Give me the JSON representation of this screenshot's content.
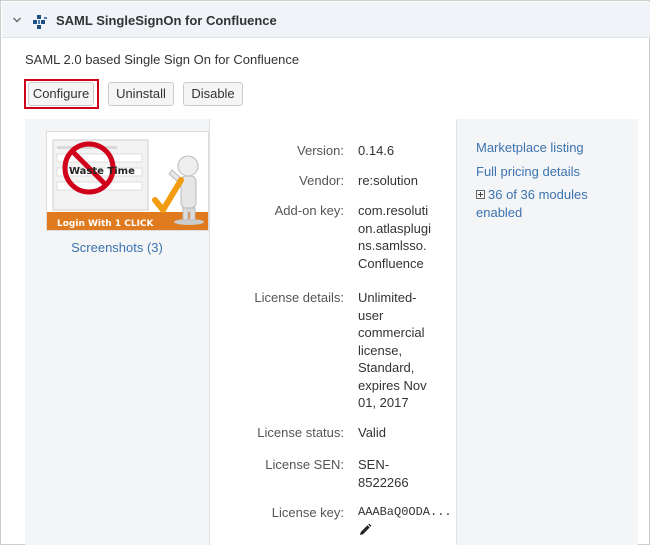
{
  "plugin": {
    "name": "SAML SingleSignOn for Confluence",
    "description": "SAML 2.0 based Single Sign On for Confluence"
  },
  "actions": {
    "configure": "Configure",
    "uninstall": "Uninstall",
    "disable": "Disable"
  },
  "thumbnail": {
    "line1": "Waste Time",
    "line2": "Login With 1 CLICK",
    "screenshots_link": "Screenshots (3)"
  },
  "details": {
    "version_label": "Version:",
    "version_value": "0.14.6",
    "vendor_label": "Vendor:",
    "vendor_value": "re:solution",
    "addon_key_label": "Add-on key:",
    "addon_key_lines": [
      "com.resoluti",
      "on.atlasplugi",
      "ns.samlsso.",
      "Confluence"
    ],
    "license_details_label": "License details:",
    "license_details_lines": [
      "Unlimited-",
      "user",
      "commercial",
      "license,",
      "Standard,",
      "expires Nov",
      "01, 2017"
    ],
    "license_status_label": "License status:",
    "license_status_value": "Valid",
    "license_sen_label": "License SEN:",
    "license_sen_lines": [
      "SEN-",
      "8522266"
    ],
    "license_key_label": "License key:",
    "license_key_value": "AAABaQ0ODA..."
  },
  "links": {
    "marketplace": "Marketplace listing",
    "pricing": "Full pricing details",
    "modules_line1": "36 of 36 modules",
    "modules_line2": "enabled"
  },
  "colors": {
    "link": "#3b73af",
    "highlight": "#d0021b",
    "header_bg": "#f0f4f8",
    "panel_bg": "#f4f5f7"
  },
  "icons": [
    "chevron-down-icon",
    "plugin-icon",
    "expand-icon",
    "pencil-icon"
  ]
}
